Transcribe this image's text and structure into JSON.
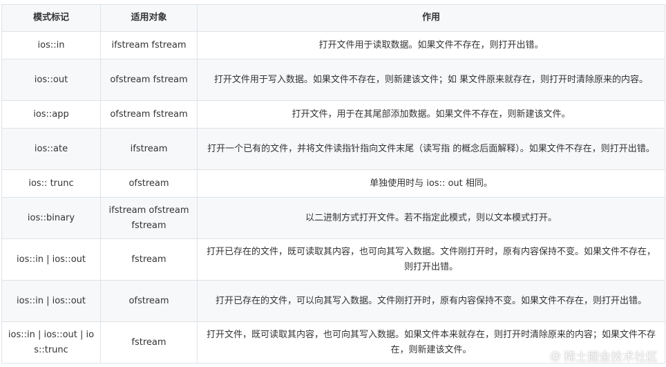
{
  "table": {
    "headers": [
      "模式标记",
      "适用对象",
      "作用"
    ],
    "rows": [
      {
        "mode": "ios::in",
        "target": "ifstream fstream",
        "effect": "打开文件用于读取数据。如果文件不存在，则打开出错。"
      },
      {
        "mode": "ios::out",
        "target": "ofstream fstream",
        "effect": "打开文件用于写入数据。如果文件不存在，则新建该文件；如 果文件原来就存在，则打开时清除原来的内容。"
      },
      {
        "mode": "ios::app",
        "target": "ofstream fstream",
        "effect": "打开文件，用于在其尾部添加数据。如果文件不存在，则新建该文件。"
      },
      {
        "mode": "ios::ate",
        "target": "ifstream",
        "effect": "打开一个已有的文件，并将文件读指针指向文件末尾（读写指 的概念后面解释）。如果文件不存在，则打开出错。"
      },
      {
        "mode": "ios:: trunc",
        "target": "ofstream",
        "effect": "单独使用时与 ios:: out 相同。"
      },
      {
        "mode": "ios::binary",
        "target": "ifstream ofstream fstream",
        "effect": "以二进制方式打开文件。若不指定此模式，则以文本模式打开。"
      },
      {
        "mode": "ios::in | ios::out",
        "target": "fstream",
        "effect": "打开已存在的文件，既可读取其内容，也可向其写入数据。文件刚打开时，原有内容保持不变。如果文件不存在，则打开出错。"
      },
      {
        "mode": "ios::in | ios::out",
        "target": "ofstream",
        "effect": "打开已存在的文件，可以向其写入数据。文件刚打开时，原有内容保持不变。如果文件不存在，则打开出错。"
      },
      {
        "mode": "ios::in | ios::out | ios::trunc",
        "target": "fstream",
        "effect": "打开文件，既可读取其内容，也可向其写入数据。如果文件本来就存在，则打开时清除原来的内容；如果文件不存在，则新建该文件。"
      }
    ]
  },
  "watermark": {
    "at": "@",
    "text": "稀土掘金技术社区"
  }
}
